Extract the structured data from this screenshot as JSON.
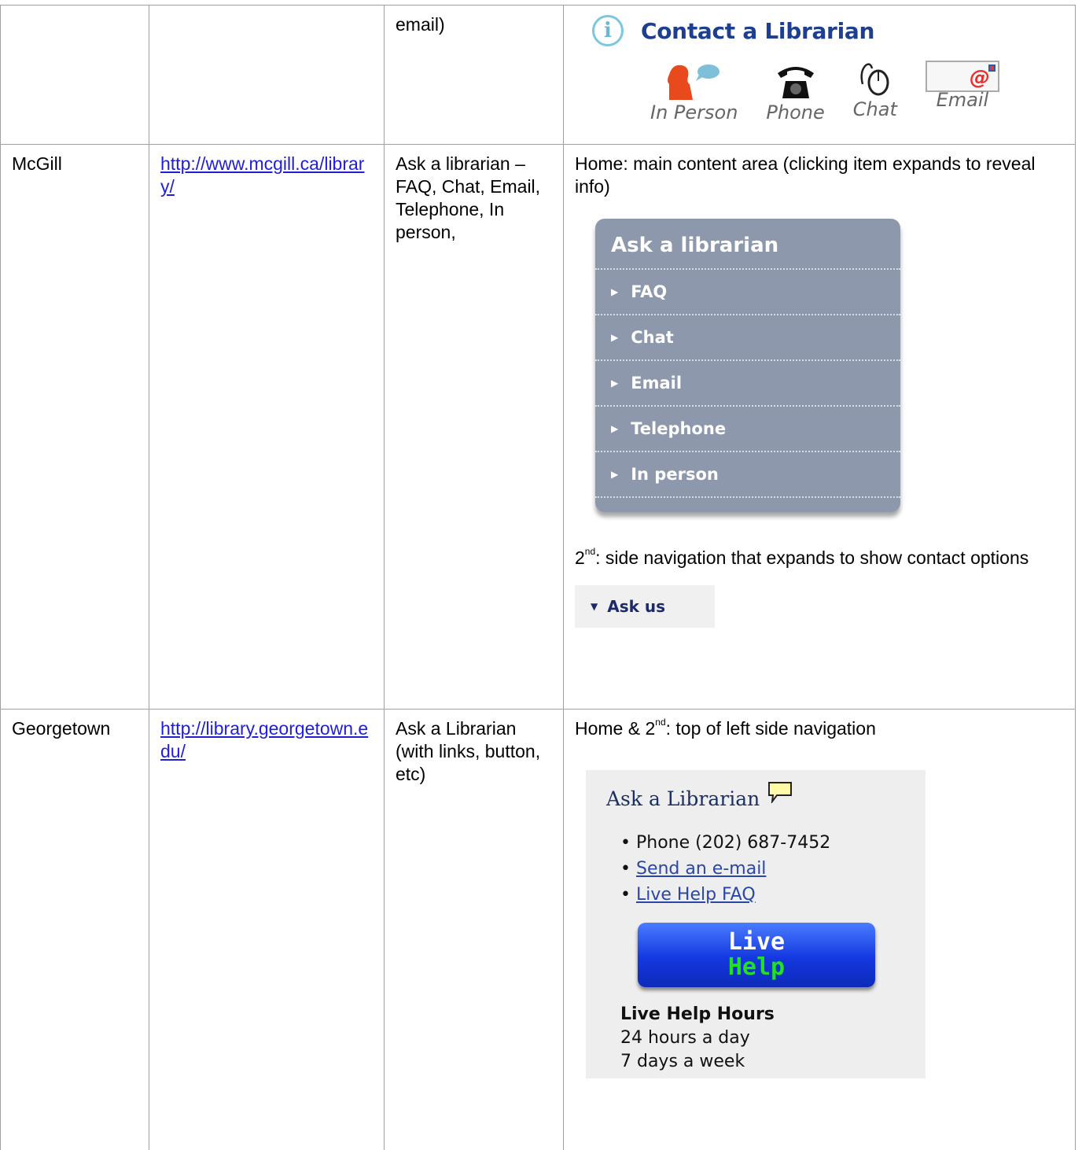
{
  "row0": {
    "col3": "email)",
    "widget": {
      "title": "Contact a Librarian",
      "options": [
        "In Person",
        "Phone",
        "Chat",
        "Email"
      ]
    }
  },
  "rows": {
    "mcgill": {
      "name": "McGill",
      "url": "http://www.mcgill.ca/library/",
      "service": "Ask a librarian –FAQ, Chat, Email, Telephone, In person,",
      "placement1": "Home: main content area (clicking item expands to reveal info)",
      "panel_title": "Ask a librarian",
      "panel_items": [
        "FAQ",
        "Chat",
        "Email",
        "Telephone",
        "In person"
      ],
      "placement2_prefix": "2",
      "placement2_sup": "nd",
      "placement2_text": ": side navigation that expands to show contact options",
      "ask_us": "Ask us"
    },
    "georgetown": {
      "name": "Georgetown",
      "url": "http://library.georgetown.edu/",
      "service": "Ask a Librarian (with links, button, etc)",
      "placement_prefix": "Home & 2",
      "placement_sup": "nd",
      "placement_text": ": top of left side navigation",
      "panel_title": "Ask a Librarian",
      "phone": "Phone (202) 687-7452",
      "email_link": "Send an e-mail",
      "faq_link": "Live Help FAQ",
      "button_line1": "Live",
      "button_line2": "Help",
      "hours_title": "Live Help Hours",
      "hours_line1": "24 hours a day",
      "hours_line2": "7 days a week"
    }
  }
}
